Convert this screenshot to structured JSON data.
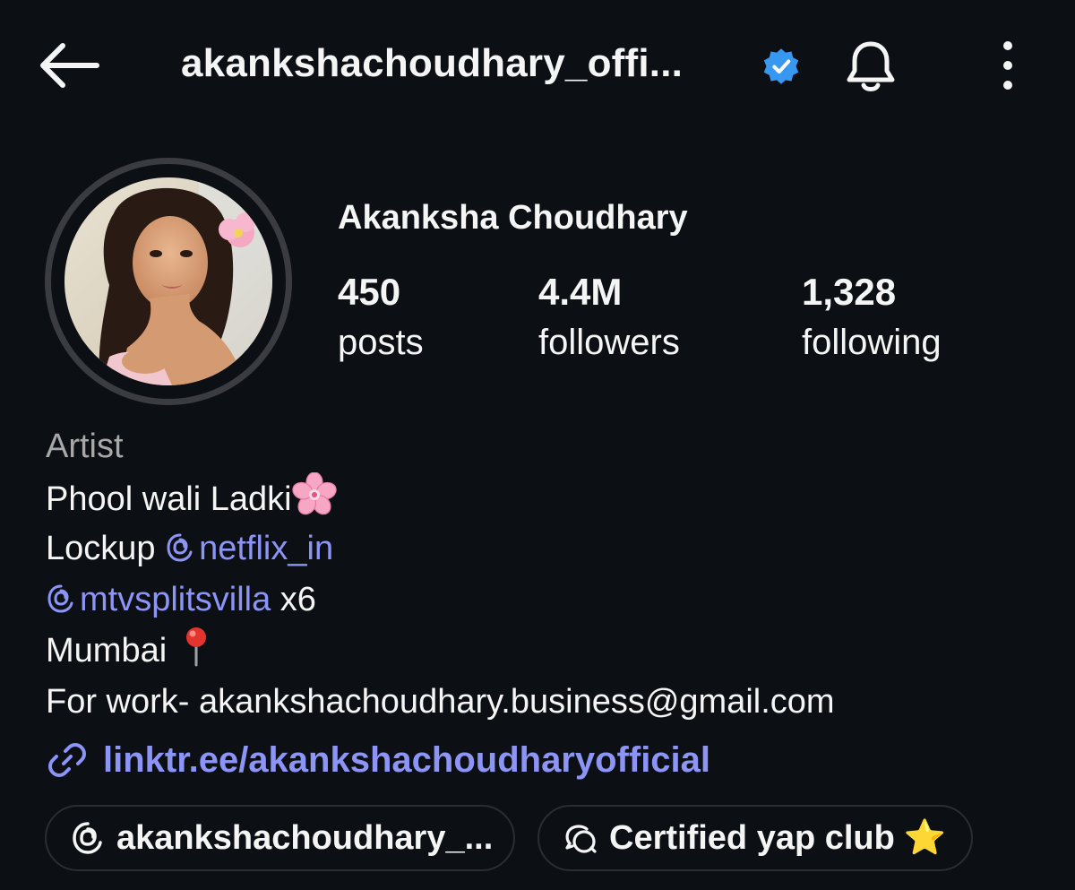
{
  "header": {
    "username": "akankshachoudhary_offi...",
    "back_icon": "arrow-left-icon",
    "verified_icon": "verified-badge-icon",
    "bell_icon": "bell-icon",
    "more_icon": "more-vertical-icon"
  },
  "profile": {
    "display_name": "Akanksha Choudhary",
    "stats": {
      "posts": {
        "value": "450",
        "label": "posts"
      },
      "followers": {
        "value": "4.4M",
        "label": "followers"
      },
      "following": {
        "value": "1,328",
        "label": "following"
      }
    }
  },
  "bio": {
    "category": "Artist",
    "line1": "Phool wali Ladki",
    "line2_prefix": "Lockup ",
    "line2_mention": "netflix_in",
    "line3_mention": "mtvsplitsvilla",
    "line3_suffix": " x6",
    "line4": "Mumbai",
    "line5": "For work- akankshachoudhary.business@gmail.com",
    "link": "linktr.ee/akankshachoudharyofficial"
  },
  "chips": {
    "threads_label": "akankshachoudhary_...",
    "channel_label": "Certified yap club",
    "channel_star": "⭐"
  },
  "colors": {
    "background": "#0c1014",
    "text": "#f5f5f5",
    "muted": "#a8a8a8",
    "link": "#8c94f5",
    "verified": "#3897f0"
  }
}
